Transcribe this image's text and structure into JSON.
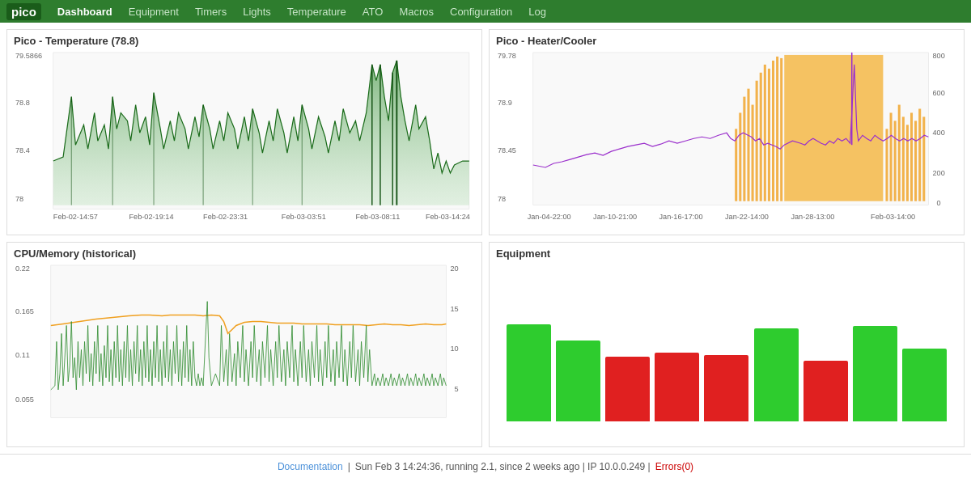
{
  "app": {
    "brand": "pico",
    "nav_items": [
      {
        "label": "Dashboard",
        "active": true
      },
      {
        "label": "Equipment",
        "active": false
      },
      {
        "label": "Timers",
        "active": false
      },
      {
        "label": "Lights",
        "active": false
      },
      {
        "label": "Temperature",
        "active": false
      },
      {
        "label": "ATO",
        "active": false
      },
      {
        "label": "Macros",
        "active": false
      },
      {
        "label": "Configuration",
        "active": false
      },
      {
        "label": "Log",
        "active": false
      }
    ]
  },
  "charts": {
    "temperature": {
      "title": "Pico - Temperature (78.8)",
      "y_min": 78,
      "y_max": 79.5866,
      "y_labels": [
        "79.5866",
        "78.8",
        "78.4",
        "78"
      ],
      "x_labels": [
        "Feb-02-14:57",
        "Feb-02-19:14",
        "Feb-02-23:31",
        "Feb-03-03:51",
        "Feb-03-08:11",
        "Feb-03-14:24"
      ]
    },
    "heater_cooler": {
      "title": "Pico - Heater/Cooler",
      "y_left_labels": [
        "79.78",
        "78.9",
        "78.45",
        "78"
      ],
      "y_right_labels": [
        "800",
        "600",
        "400",
        "200",
        "0"
      ],
      "x_labels": [
        "Jan-04-22:00",
        "Jan-10-21:00",
        "Jan-16-17:00",
        "Jan-22-14:00",
        "Jan-28-13:00",
        "Feb-03-14:00"
      ]
    },
    "cpu_memory": {
      "title": "CPU/Memory (historical)",
      "y_left_labels": [
        "0.22",
        "0.165",
        "0.11",
        "0.055"
      ],
      "y_right_labels": [
        "20",
        "15",
        "10",
        "5"
      ]
    },
    "equipment": {
      "title": "Equipment",
      "bars": [
        {
          "color": "green",
          "height": 120
        },
        {
          "color": "green",
          "height": 100
        },
        {
          "color": "red",
          "height": 80
        },
        {
          "color": "red",
          "height": 85
        },
        {
          "color": "red",
          "height": 80
        },
        {
          "color": "green",
          "height": 110
        },
        {
          "color": "red",
          "height": 75
        },
        {
          "color": "green",
          "height": 115
        },
        {
          "color": "green",
          "height": 90
        }
      ]
    }
  },
  "footer": {
    "doc_label": "Documentation",
    "status": "Sun Feb 3 14:24:36,  running 2.1,  since 2 weeks ago  |  IP 10.0.0.249  |",
    "errors": "Errors(0)"
  }
}
